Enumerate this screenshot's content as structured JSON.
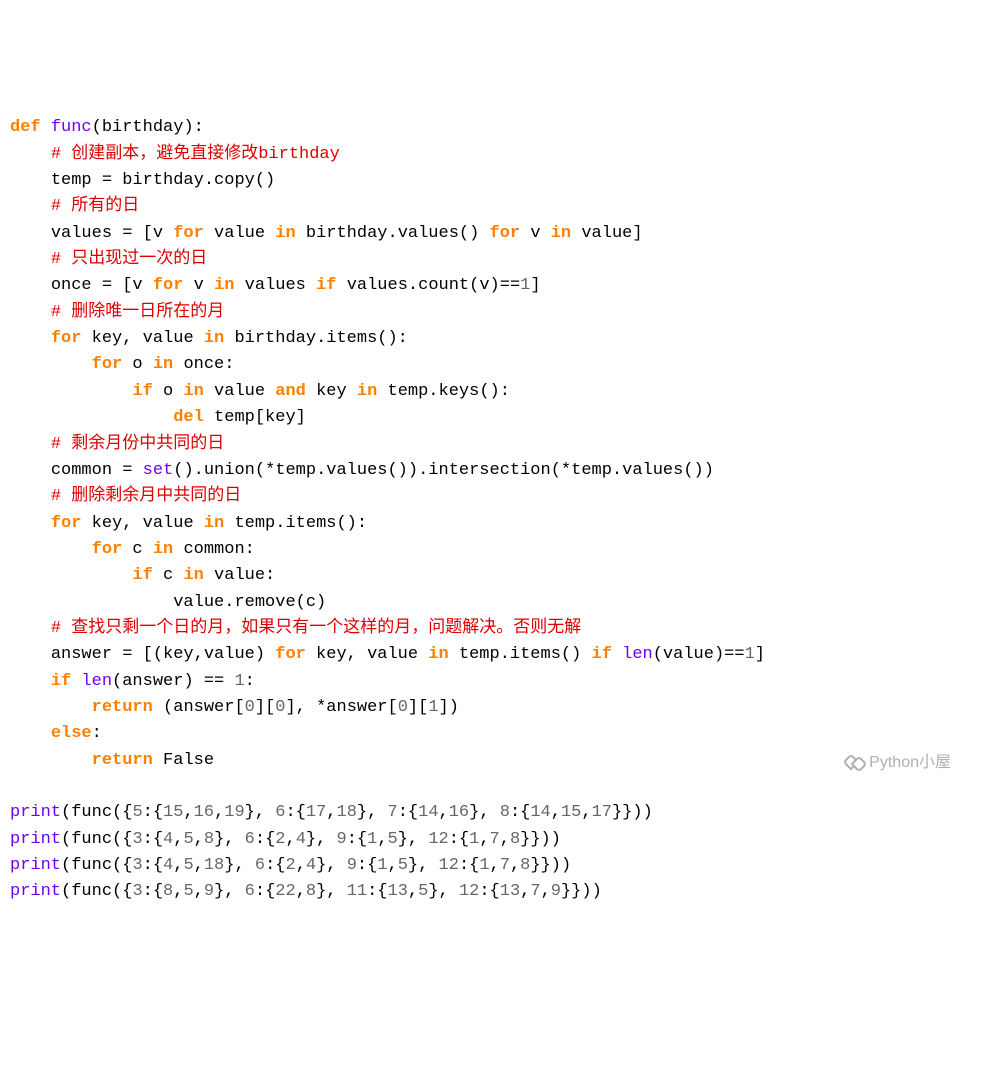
{
  "code": {
    "l1": {
      "a": "def ",
      "b": "func",
      "c": "(birthday):"
    },
    "l2": "# 创建副本，避免直接修改birthday",
    "l3": "temp = birthday.copy()",
    "l4": "# 所有的日",
    "l5": {
      "a": "values = [v ",
      "b": "for",
      "c": " value ",
      "d": "in",
      "e": " birthday.values() ",
      "f": "for",
      "g": " v ",
      "h": "in",
      "i": " value]"
    },
    "l6": "# 只出现过一次的日",
    "l7": {
      "a": "once = [v ",
      "b": "for",
      "c": " v ",
      "d": "in",
      "e": " values ",
      "f": "if",
      "g": " values.count(v)==",
      "h": "1",
      "i": "]"
    },
    "l8": "# 删除唯一日所在的月",
    "l9": {
      "a": "for",
      "b": " key, value ",
      "c": "in",
      "d": " birthday.items():"
    },
    "l10": {
      "a": "for",
      "b": " o ",
      "c": "in",
      "d": " once:"
    },
    "l11": {
      "a": "if",
      "b": " o ",
      "c": "in",
      "d": " value ",
      "e": "and",
      "f": " key ",
      "g": "in",
      "h": " temp.keys():"
    },
    "l12": {
      "a": "del",
      "b": " temp[key]"
    },
    "l13": "# 剩余月份中共同的日",
    "l14": {
      "a": "common = ",
      "b": "set",
      "c": "().union(*temp.values()).intersection(*temp.values())"
    },
    "l15": "# 删除剩余月中共同的日",
    "l16": {
      "a": "for",
      "b": " key, value ",
      "c": "in",
      "d": " temp.items():"
    },
    "l17": {
      "a": "for",
      "b": " c ",
      "c": "in",
      "d": " common:"
    },
    "l18": {
      "a": "if",
      "b": " c ",
      "c": "in",
      "d": " value:"
    },
    "l19": "value.remove(c)",
    "l20": "# 查找只剩一个日的月，如果只有一个这样的月，问题解决。否则无解",
    "l21": {
      "a": "answer = [(key,value) ",
      "b": "for",
      "c": " key, value ",
      "d": "in",
      "e": " temp.items() ",
      "f": "if",
      "g": " ",
      "h": "len",
      "i": "(value)==",
      "j": "1",
      "k": "]"
    },
    "l22": {
      "a": "if",
      "b": " ",
      "c": "len",
      "d": "(answer) == ",
      "e": "1",
      "f": ":"
    },
    "l23": {
      "a": "return",
      "b": " (answer[",
      "c": "0",
      "d": "][",
      "e": "0",
      "f": "], *answer[",
      "g": "0",
      "h": "][",
      "i": "1",
      "j": "])"
    },
    "l24": {
      "a": "else",
      "b": ":"
    },
    "l25": {
      "a": "return",
      "b": " False"
    },
    "p1": {
      "a": "print",
      "b": "(func({",
      "c": "5",
      "d": ":{",
      "e": "15",
      "f": ",",
      "g": "16",
      "h": ",",
      "i": "19",
      "j": "}, ",
      "k": "6",
      "l": ":{",
      "m": "17",
      "n": ",",
      "o": "18",
      "p": "}, ",
      "q": "7",
      "r": ":{",
      "s": "14",
      "t": ",",
      "u": "16",
      "v": "}, ",
      "w": "8",
      "x": ":{",
      "y": "14",
      "z": ",",
      "aa": "15",
      "ab": ",",
      "ac": "17",
      "ad": "}}))"
    },
    "p2": {
      "a": "print",
      "b": "(func({",
      "c": "3",
      "d": ":{",
      "e": "4",
      "f": ",",
      "g": "5",
      "h": ",",
      "i": "8",
      "j": "}, ",
      "k": "6",
      "l": ":{",
      "m": "2",
      "n": ",",
      "o": "4",
      "p": "}, ",
      "q": "9",
      "r": ":{",
      "s": "1",
      "t": ",",
      "u": "5",
      "v": "}, ",
      "w": "12",
      "x": ":{",
      "y": "1",
      "z": ",",
      "aa": "7",
      "ab": ",",
      "ac": "8",
      "ad": "}}))"
    },
    "p3": {
      "a": "print",
      "b": "(func({",
      "c": "3",
      "d": ":{",
      "e": "4",
      "f": ",",
      "g": "5",
      "h": ",",
      "i": "18",
      "j": "}, ",
      "k": "6",
      "l": ":{",
      "m": "2",
      "n": ",",
      "o": "4",
      "p": "}, ",
      "q": "9",
      "r": ":{",
      "s": "1",
      "t": ",",
      "u": "5",
      "v": "}, ",
      "w": "12",
      "x": ":{",
      "y": "1",
      "z": ",",
      "aa": "7",
      "ab": ",",
      "ac": "8",
      "ad": "}}))"
    },
    "p4": {
      "a": "print",
      "b": "(func({",
      "c": "3",
      "d": ":{",
      "e": "8",
      "f": ",",
      "g": "5",
      "h": ",",
      "i": "9",
      "j": "}, ",
      "k": "6",
      "l": ":{",
      "m": "22",
      "n": ",",
      "o": "8",
      "p": "}, ",
      "q": "11",
      "r": ":{",
      "s": "13",
      "t": ",",
      "u": "5",
      "v": "}, ",
      "w": "12",
      "x": ":{",
      "y": "13",
      "z": ",",
      "aa": "7",
      "ab": ",",
      "ac": "9",
      "ad": "}}))"
    }
  },
  "watermark": "Python小屋"
}
